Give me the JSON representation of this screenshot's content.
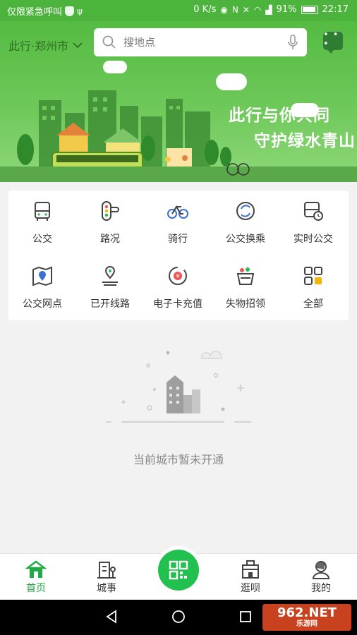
{
  "status_bar": {
    "carrier": "仅限紧急呼叫",
    "speed": "0 K/s",
    "battery": "91%",
    "time": "22:17"
  },
  "header": {
    "city_select": "此行·郑州市",
    "search_placeholder": "搜地点"
  },
  "banner": {
    "slogan_line1": "此行与你共同",
    "slogan_line2": "守护绿水青山"
  },
  "services": [
    {
      "label": "公交",
      "icon": "bus-icon"
    },
    {
      "label": "路况",
      "icon": "traffic-light-icon"
    },
    {
      "label": "骑行",
      "icon": "bicycle-icon"
    },
    {
      "label": "公交换乘",
      "icon": "transfer-icon"
    },
    {
      "label": "实时公交",
      "icon": "realtime-bus-icon"
    },
    {
      "label": "公交网点",
      "icon": "map-pin-icon"
    },
    {
      "label": "已开线路",
      "icon": "route-icon"
    },
    {
      "label": "电子卡充值",
      "icon": "card-recharge-icon"
    },
    {
      "label": "失物招领",
      "icon": "lost-found-icon"
    },
    {
      "label": "全部",
      "icon": "grid-icon"
    }
  ],
  "empty_state": {
    "message": "当前城市暂未开通"
  },
  "tabs": [
    {
      "label": "首页",
      "active": true
    },
    {
      "label": "城事",
      "active": false
    },
    {
      "label": "逛呗",
      "active": false
    },
    {
      "label": "我的",
      "active": false
    }
  ],
  "watermark": {
    "brand": "962.NET",
    "site": "乐游网"
  },
  "colors": {
    "primary_green": "#22c04f",
    "banner_green": "#54bb42",
    "active_tab": "#22a845"
  }
}
